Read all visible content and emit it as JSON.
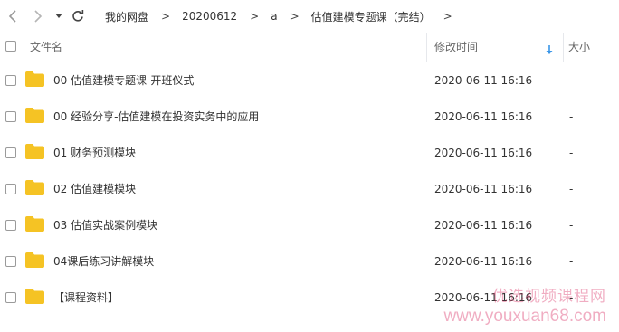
{
  "nav": {
    "back_icon": "chevron-left-icon",
    "forward_icon": "chevron-right-icon",
    "history_icon": "caret-down-icon",
    "refresh_icon": "refresh-icon",
    "breadcrumbs": [
      "我的网盘",
      "20200612",
      "a",
      "估值建模专题课（完结）"
    ],
    "separator": ">"
  },
  "header": {
    "name_label": "文件名",
    "time_label": "修改时间",
    "size_label": "大小",
    "sort_icon": "sort-down-arrow-icon"
  },
  "files": [
    {
      "name": "00 估值建模专题课-开班仪式",
      "modified": "2020-06-11 16:16",
      "size": "-"
    },
    {
      "name": "00 经验分享-估值建模在投资实务中的应用",
      "modified": "2020-06-11 16:16",
      "size": "-"
    },
    {
      "name": "01 财务预测模块",
      "modified": "2020-06-11 16:16",
      "size": "-"
    },
    {
      "name": "02 估值建模模块",
      "modified": "2020-06-11 16:16",
      "size": "-"
    },
    {
      "name": "03 估值实战案例模块",
      "modified": "2020-06-11 16:16",
      "size": "-"
    },
    {
      "name": "04课后练习讲解模块",
      "modified": "2020-06-11 16:16",
      "size": "-"
    },
    {
      "name": "【课程资料】",
      "modified": "2020-06-11 16:16",
      "size": "-"
    }
  ],
  "watermark": {
    "line1": "优选视频课程网",
    "line2": "www.youxuan68.com"
  },
  "colors": {
    "folder": "#f5c324",
    "accent": "#3a96e8",
    "watermark": "#dc3c6e"
  }
}
